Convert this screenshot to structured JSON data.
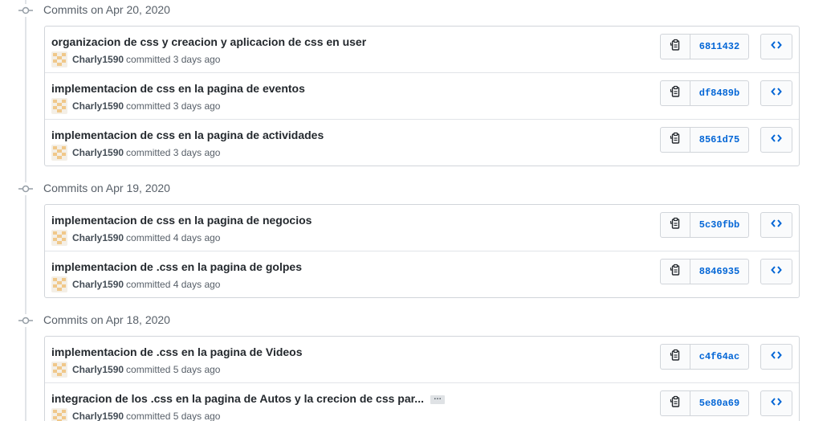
{
  "groups": [
    {
      "title": "Commits on Apr 20, 2020",
      "commits": [
        {
          "message": "organizacion de css y creacion y aplicacion de css en user",
          "author": "Charly1590",
          "action": "committed",
          "time": "3 days ago",
          "sha": "6811432",
          "truncated": false
        },
        {
          "message": "implementacion de css en la pagina de eventos",
          "author": "Charly1590",
          "action": "committed",
          "time": "3 days ago",
          "sha": "df8489b",
          "truncated": false
        },
        {
          "message": "implementacion de css en la pagina de actividades",
          "author": "Charly1590",
          "action": "committed",
          "time": "3 days ago",
          "sha": "8561d75",
          "truncated": false
        }
      ]
    },
    {
      "title": "Commits on Apr 19, 2020",
      "commits": [
        {
          "message": "implementacion de css en la pagina de negocios",
          "author": "Charly1590",
          "action": "committed",
          "time": "4 days ago",
          "sha": "5c30fbb",
          "truncated": false
        },
        {
          "message": "implementacion de .css en la pagina de golpes",
          "author": "Charly1590",
          "action": "committed",
          "time": "4 days ago",
          "sha": "8846935",
          "truncated": false
        }
      ]
    },
    {
      "title": "Commits on Apr 18, 2020",
      "commits": [
        {
          "message": "implementacion de .css en la pagina de Videos",
          "author": "Charly1590",
          "action": "committed",
          "time": "5 days ago",
          "sha": "c4f64ac",
          "truncated": false
        },
        {
          "message": "integracion de los .css en la pagina de Autos y la crecion de css par...",
          "author": "Charly1590",
          "action": "committed",
          "time": "5 days ago",
          "sha": "5e80a69",
          "truncated": true
        }
      ]
    }
  ],
  "ellipsis_label": "…",
  "icons": {
    "commit": "git-commit-icon",
    "copy": "clipboard-icon",
    "browse": "code-icon",
    "avatar": "identicon-avatar"
  },
  "colors": {
    "sha_link": "#0366d6",
    "border": "#d1d5da",
    "timeline": "#e1e4e8",
    "identicon": "#f0c88a"
  }
}
